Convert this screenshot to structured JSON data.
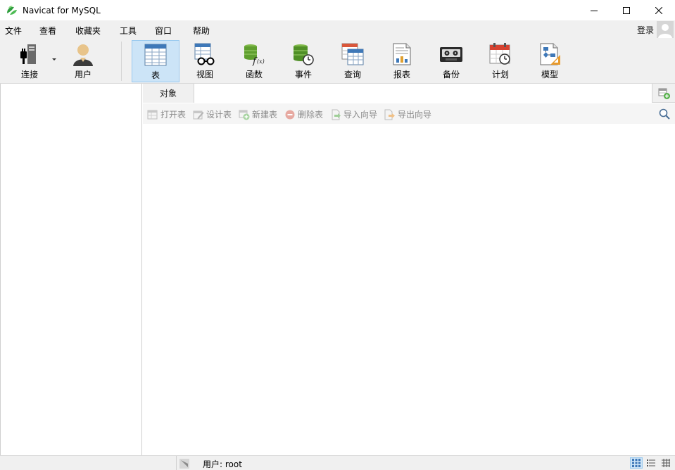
{
  "window": {
    "title": "Navicat for MySQL"
  },
  "menu": {
    "items": [
      "文件",
      "查看",
      "收藏夹",
      "工具",
      "窗口",
      "帮助"
    ],
    "login": "登录"
  },
  "toolbar": {
    "connect": "连接",
    "user": "用户",
    "table": "表",
    "view": "视图",
    "function": "函数",
    "event": "事件",
    "query": "查询",
    "report": "报表",
    "backup": "备份",
    "schedule": "计划",
    "model": "模型",
    "active": "表"
  },
  "tabs": {
    "objects": "对象"
  },
  "actions": {
    "open_table": "打开表",
    "design_table": "设计表",
    "new_table": "新建表",
    "delete_table": "删除表",
    "import_wizard": "导入向导",
    "export_wizard": "导出向导"
  },
  "status": {
    "user": "用户: root"
  },
  "colors": {
    "accent": "#cce4f7",
    "accent_border": "#99c9ef",
    "chrome": "#f0f0f0"
  }
}
